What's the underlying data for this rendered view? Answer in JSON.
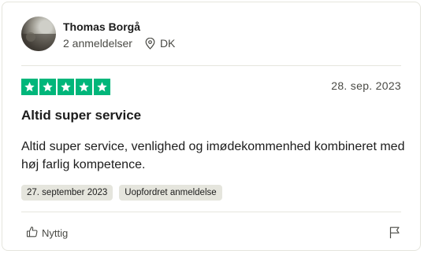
{
  "reviewer": {
    "name": "Thomas Borgå",
    "review_count": "2 anmeldelser",
    "country": "DK"
  },
  "review": {
    "rating": 5,
    "date": "28. sep. 2023",
    "title": "Altid super service",
    "body": "Altid super service, venlighed og imødekommenhed kombineret med høj farlig kompetence.",
    "tags": [
      "27. september 2023",
      "Uopfordret anmeldelse"
    ]
  },
  "actions": {
    "useful_label": "Nyttig"
  },
  "colors": {
    "star_green": "#00b67a",
    "border": "#e5e5dd",
    "tag_bg": "#e5e5dd"
  },
  "icons": {
    "location": "map-pin-icon",
    "like": "thumbs-up-icon",
    "report": "flag-icon"
  }
}
